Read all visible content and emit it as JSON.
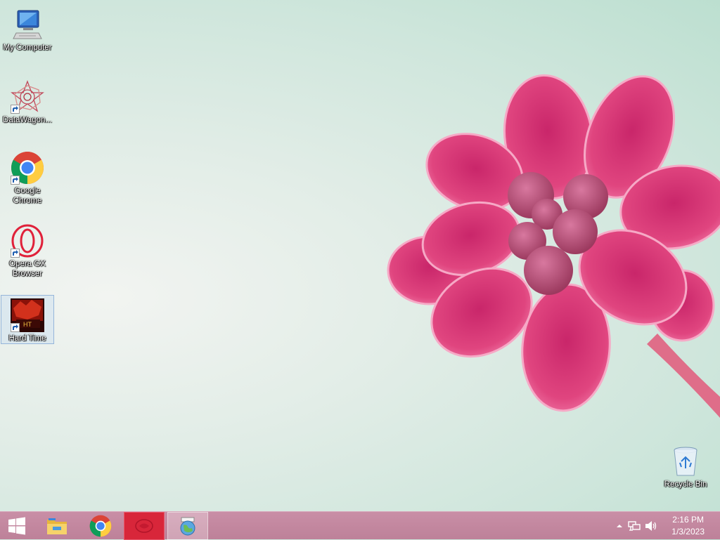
{
  "desktop": {
    "icons": [
      {
        "label": "My Computer",
        "icon": "computer-icon"
      },
      {
        "label": "DataWagon...",
        "icon": "datawagon-icon",
        "shortcut": true
      },
      {
        "label": "Google Chrome",
        "icon": "chrome-icon",
        "shortcut": true
      },
      {
        "label": "Opera GX Browser",
        "icon": "opera-gx-icon",
        "shortcut": true
      },
      {
        "label": "Hard Time",
        "icon": "hard-time-icon",
        "shortcut": true,
        "selected": true
      },
      {
        "label": "Recycle Bin",
        "icon": "recycle-bin-icon"
      }
    ],
    "wallpaper": {
      "petal_color": "#e0457f",
      "background_color": "#cfe6dc"
    }
  },
  "taskbar": {
    "buttons": [
      {
        "icon": "windows-start-icon"
      },
      {
        "icon": "file-explorer-icon"
      },
      {
        "icon": "chrome-icon"
      },
      {
        "icon": "hard-time-app-icon",
        "state": "active"
      },
      {
        "icon": "installer-globe-icon",
        "state": "open"
      }
    ],
    "tray": {
      "icons": [
        "chevron-up-icon",
        "network-icon",
        "volume-icon"
      ]
    },
    "clock": {
      "time": "2:16 PM",
      "date": "1/3/2023"
    },
    "color": "#c58aa2"
  }
}
